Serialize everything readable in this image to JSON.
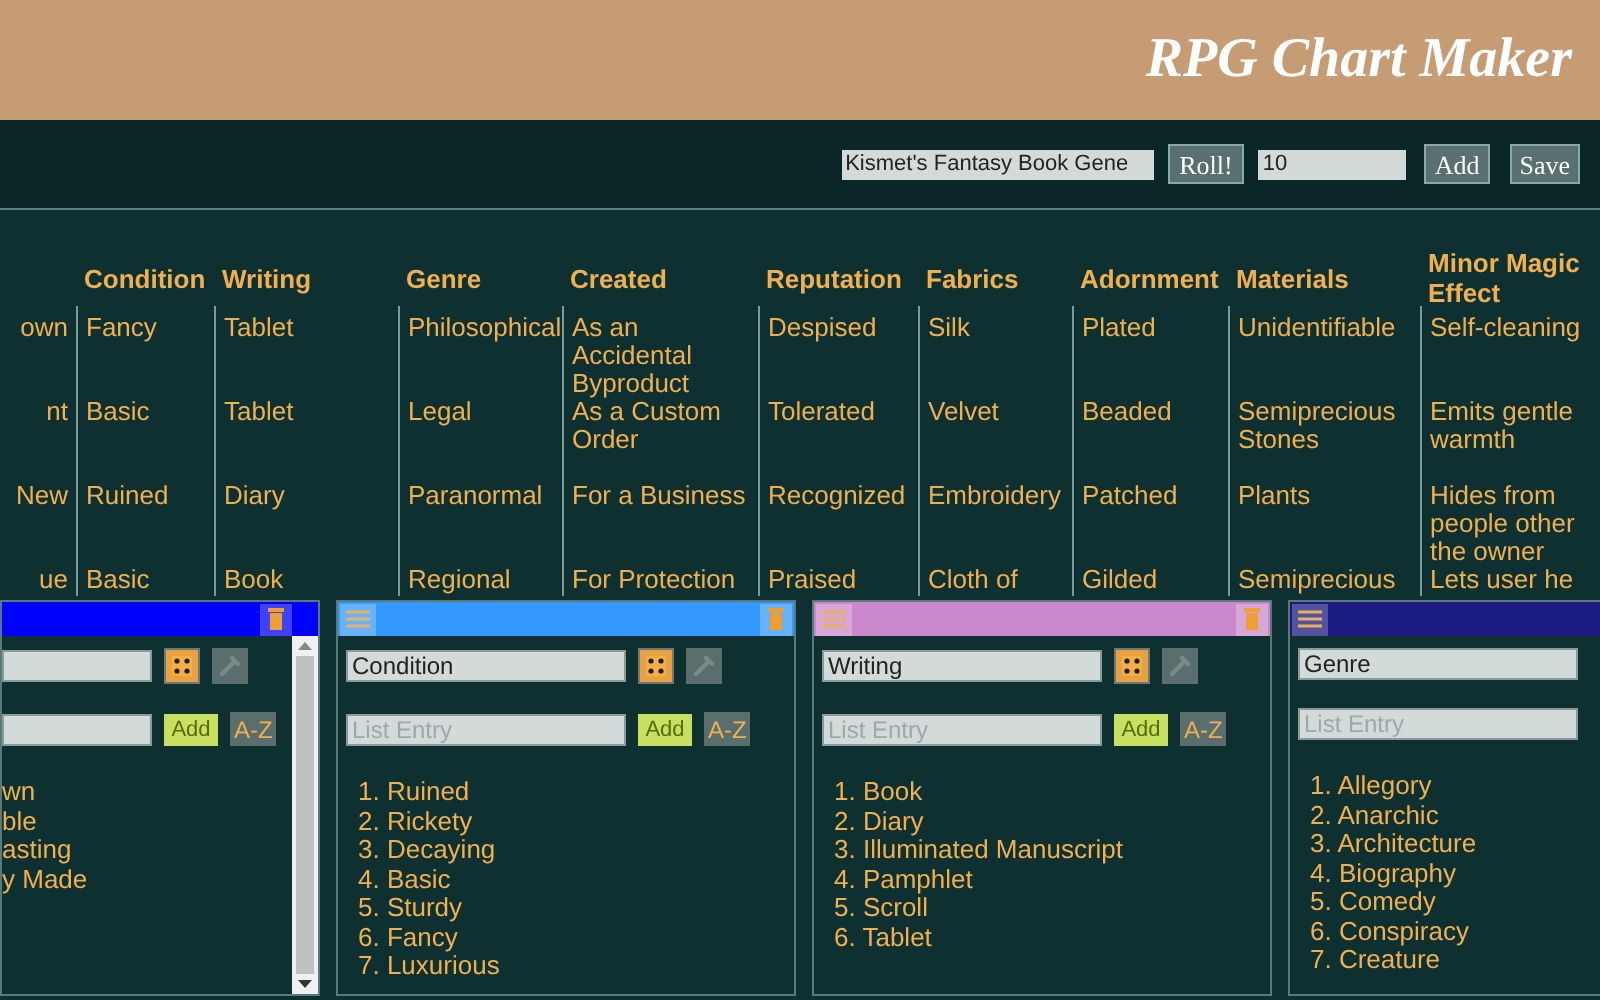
{
  "header": {
    "title": "RPG Chart Maker"
  },
  "toolbar": {
    "chart_name": "Kismet's Fantasy Book Gene",
    "roll_button": "Roll!",
    "count": "10",
    "add_button": "Add",
    "save_button": "Save"
  },
  "table": {
    "columns": [
      {
        "cells": [
          "own",
          "nt",
          "New",
          "ue"
        ]
      },
      {
        "header": "Condition",
        "cells": [
          "Fancy",
          "Basic",
          "Ruined",
          "Basic"
        ]
      },
      {
        "header": "Writing",
        "cells": [
          "Tablet",
          "Tablet",
          "Diary",
          "Book"
        ]
      },
      {
        "header": "Genre",
        "cells": [
          "Philosophical",
          "Legal",
          "Paranormal",
          "Regional"
        ]
      },
      {
        "header": "Created",
        "cells": [
          "As an Accidental Byproduct",
          "As a Custom Order",
          "For a Business",
          "For Protection"
        ]
      },
      {
        "header": "Reputation",
        "cells": [
          "Despised",
          "Tolerated",
          "Recognized",
          "Praised"
        ]
      },
      {
        "header": "Fabrics",
        "cells": [
          "Silk",
          "Velvet",
          "Embroidery",
          "Cloth of"
        ]
      },
      {
        "header": "Adornment",
        "cells": [
          "Plated",
          "Beaded",
          "Patched",
          "Gilded"
        ]
      },
      {
        "header": "Materials",
        "cells": [
          "Unidentifiable",
          "Semiprecious Stones",
          "Plants",
          "Semiprecious"
        ]
      },
      {
        "header": "Minor Magic Effect",
        "cells": [
          "Self-cleaning",
          "Emits gentle warmth",
          "Hides from people other the owner",
          "Lets user he"
        ]
      }
    ]
  },
  "panels": [
    {
      "kind": "partial",
      "color": "#0000ff",
      "add_button": "Add",
      "sort_button": "A-Z",
      "items": [
        "wn",
        "ble",
        "asting",
        "y Made"
      ]
    },
    {
      "kind": "full",
      "color": "#3399ff",
      "name": "Condition",
      "placeholder": "List Entry",
      "add_button": "Add",
      "sort_button": "A-Z",
      "items": [
        "1. Ruined",
        "2. Rickety",
        "3. Decaying",
        "4. Basic",
        "5. Sturdy",
        "6. Fancy",
        "7. Luxurious"
      ]
    },
    {
      "kind": "full",
      "color": "#cc88cc",
      "name": "Writing",
      "placeholder": "List Entry",
      "add_button": "Add",
      "sort_button": "A-Z",
      "items": [
        "1. Book",
        "2. Diary",
        "3. Illuminated Manuscript",
        "4. Pamphlet",
        "5. Scroll",
        "6. Tablet"
      ]
    },
    {
      "kind": "full",
      "color": "#1a1a80",
      "name": "Genre",
      "placeholder": "List Entry",
      "items": [
        "1. Allegory",
        "2. Anarchic",
        "3. Architecture",
        "4. Biography",
        "5. Comedy",
        "6. Conspiracy",
        "7. Creature"
      ]
    }
  ]
}
